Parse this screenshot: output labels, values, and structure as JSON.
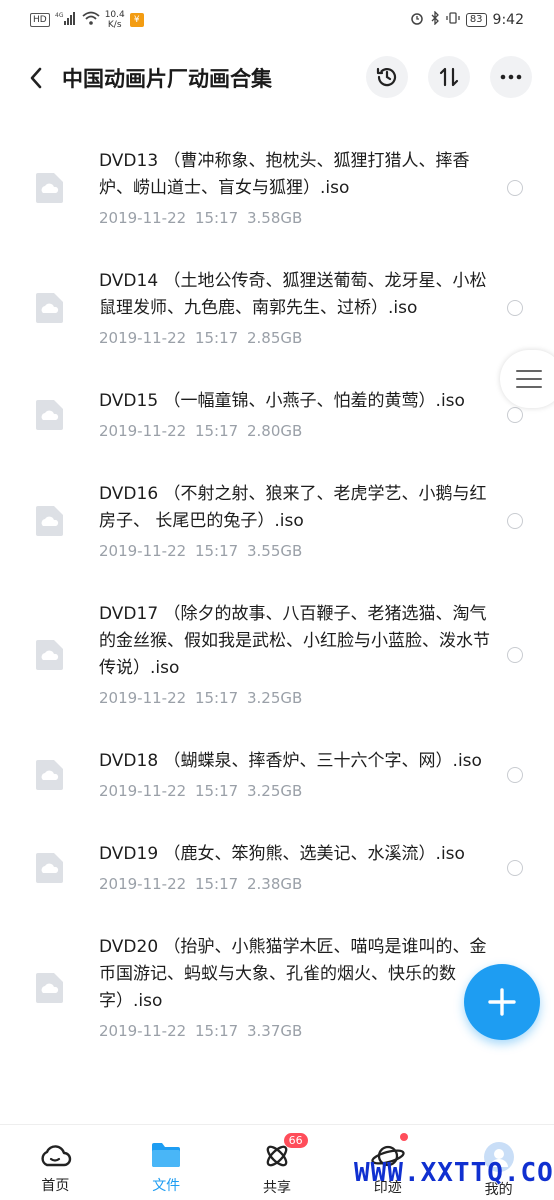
{
  "status_bar": {
    "hd": "HD",
    "network": "4G",
    "speed_value": "10.4",
    "speed_unit": "K/s",
    "battery": "83",
    "time": "9:42"
  },
  "header": {
    "title": "中国动画片厂动画合集",
    "back_icon": "chevron-left-icon",
    "actions": [
      "history-icon",
      "sort-icon",
      "more-icon"
    ]
  },
  "files": [
    {
      "name": "DVD13 （曹冲称象、抱枕头、狐狸打猎人、摔香炉、崂山道士、盲女与狐狸）.iso",
      "date": "2019-11-22",
      "time": "15:17",
      "size": "3.58GB"
    },
    {
      "name": "DVD14 （土地公传奇、狐狸送葡萄、龙牙星、小松鼠理发师、九色鹿、南郭先生、过桥）.iso",
      "date": "2019-11-22",
      "time": "15:17",
      "size": "2.85GB"
    },
    {
      "name": "DVD15 （一幅童锦、小燕子、怕羞的黄莺）.iso",
      "date": "2019-11-22",
      "time": "15:17",
      "size": "2.80GB"
    },
    {
      "name": "DVD16 （不射之射、狼来了、老虎学艺、小鹅与红房子、 长尾巴的兔子）.iso",
      "date": "2019-11-22",
      "time": "15:17",
      "size": "3.55GB"
    },
    {
      "name": "DVD17 （除夕的故事、八百鞭子、老猪选猫、淘气的金丝猴、假如我是武松、小红脸与小蓝脸、泼水节传说）.iso",
      "date": "2019-11-22",
      "time": "15:17",
      "size": "3.25GB"
    },
    {
      "name": "DVD18 （蝴蝶泉、摔香炉、三十六个字、网）.iso",
      "date": "2019-11-22",
      "time": "15:17",
      "size": "3.25GB"
    },
    {
      "name": "DVD19 （鹿女、笨狗熊、选美记、水溪流）.iso",
      "date": "2019-11-22",
      "time": "15:17",
      "size": "2.38GB"
    },
    {
      "name": "DVD20 （抬驴、小熊猫学木匠、喵呜是谁叫的、金币国游记、蚂蚁与大象、孔雀的烟火、快乐的数字）.iso",
      "date": "2019-11-22",
      "time": "15:17",
      "size": "3.37GB"
    }
  ],
  "bottom_nav": [
    {
      "label": "首页",
      "icon": "home-cloud-icon"
    },
    {
      "label": "文件",
      "icon": "folder-icon",
      "active": true
    },
    {
      "label": "共享",
      "icon": "share-icon",
      "badge": "66"
    },
    {
      "label": "印迹",
      "icon": "planet-icon",
      "dot": true
    },
    {
      "label": "我的",
      "icon": "avatar-icon"
    }
  ],
  "watermark": "WWW.XXTTQ.COM",
  "colors": {
    "accent": "#1e9df2",
    "badge": "#ff4d5a",
    "meta_text": "#9aa0a8"
  }
}
